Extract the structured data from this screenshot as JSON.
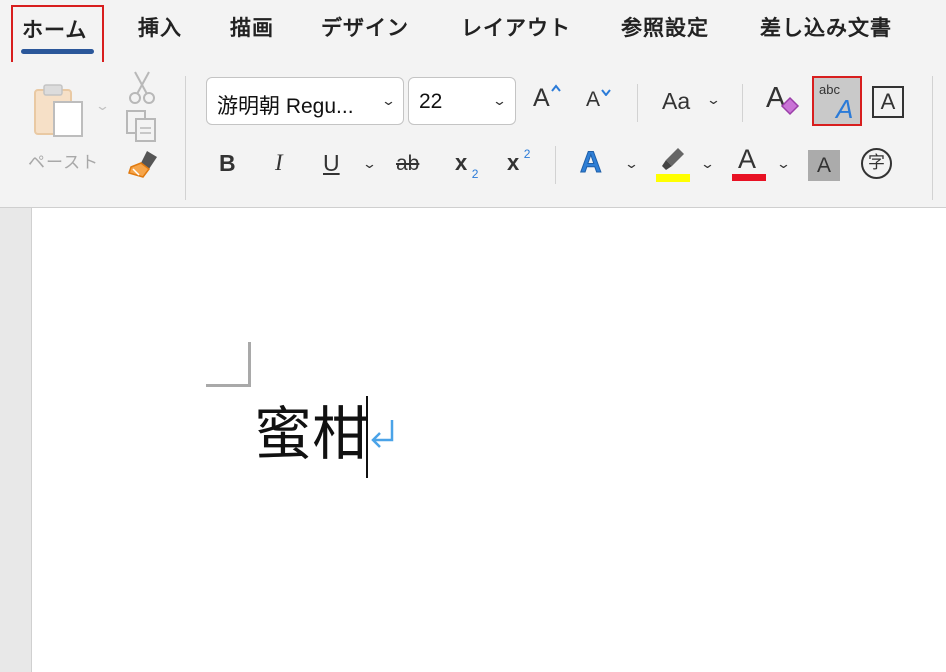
{
  "tabs": [
    {
      "label": "ホーム",
      "active": true
    },
    {
      "label": "挿入"
    },
    {
      "label": "描画"
    },
    {
      "label": "デザイン"
    },
    {
      "label": "レイアウト"
    },
    {
      "label": "参照設定"
    },
    {
      "label": "差し込み文書"
    }
  ],
  "clipboard": {
    "paste_label": "ペースト",
    "icons": [
      "paste-icon",
      "cut-icon",
      "copy-icon",
      "format-painter-icon"
    ]
  },
  "font": {
    "name": "游明朝 Regu...",
    "size": "22",
    "grow_label": "A",
    "shrink_label": "A",
    "change_case_label": "Aa",
    "clear_format_label": "A",
    "phonetic_abc": "abc",
    "phonetic_a": "A",
    "char_border_label": "A",
    "text_effects_label": "A",
    "font_color_label": "A",
    "char_shading_label": "A",
    "enclose_char_label": "字"
  },
  "format_buttons": {
    "bold": "B",
    "italic": "I",
    "underline": "U",
    "strikethrough": "ab",
    "subscript_base": "x",
    "subscript_mark": "2",
    "superscript_base": "x",
    "superscript_mark": "2"
  },
  "colors": {
    "accent": "#2b579a",
    "highlight": "#ffff00",
    "font_color": "#e81123",
    "annotation_box": "#d81e1e",
    "text_effect_blue": "#2f7fd6"
  },
  "document": {
    "text": "蜜柑"
  }
}
